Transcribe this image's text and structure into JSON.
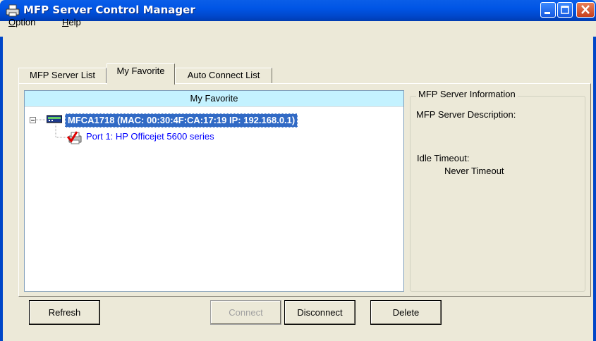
{
  "window": {
    "title": "MFP Server Control Manager",
    "icon": "printer-icon"
  },
  "menu": {
    "items": [
      {
        "label": "Option"
      },
      {
        "label": "Help"
      }
    ]
  },
  "tabs": [
    {
      "label": "MFP Server List",
      "active": false
    },
    {
      "label": "My Favorite",
      "active": true
    },
    {
      "label": "Auto Connect List",
      "active": false
    }
  ],
  "tree": {
    "header": "My Favorite",
    "server": {
      "label": "MFCA1718 (MAC: 00:30:4F:CA:17:19   IP: 192.168.0.1)",
      "icon": "network-server-icon",
      "selected": true,
      "expanded": true
    },
    "ports": [
      {
        "label": "Port 1: HP Officejet 5600 series",
        "icon": "printer-check-icon"
      }
    ]
  },
  "info": {
    "title": "MFP Server Information",
    "description_label": "MFP Server Description:",
    "description_value": "",
    "idle_label": "Idle Timeout:",
    "idle_value": "Never Timeout"
  },
  "buttons": {
    "refresh": "Refresh",
    "connect": "Connect",
    "disconnect": "Disconnect",
    "delete": "Delete"
  },
  "colors": {
    "titlebar": "#0055e5",
    "selection": "#316ac5",
    "tree_header": "#c4f2ff",
    "port_text": "#0000ff"
  }
}
